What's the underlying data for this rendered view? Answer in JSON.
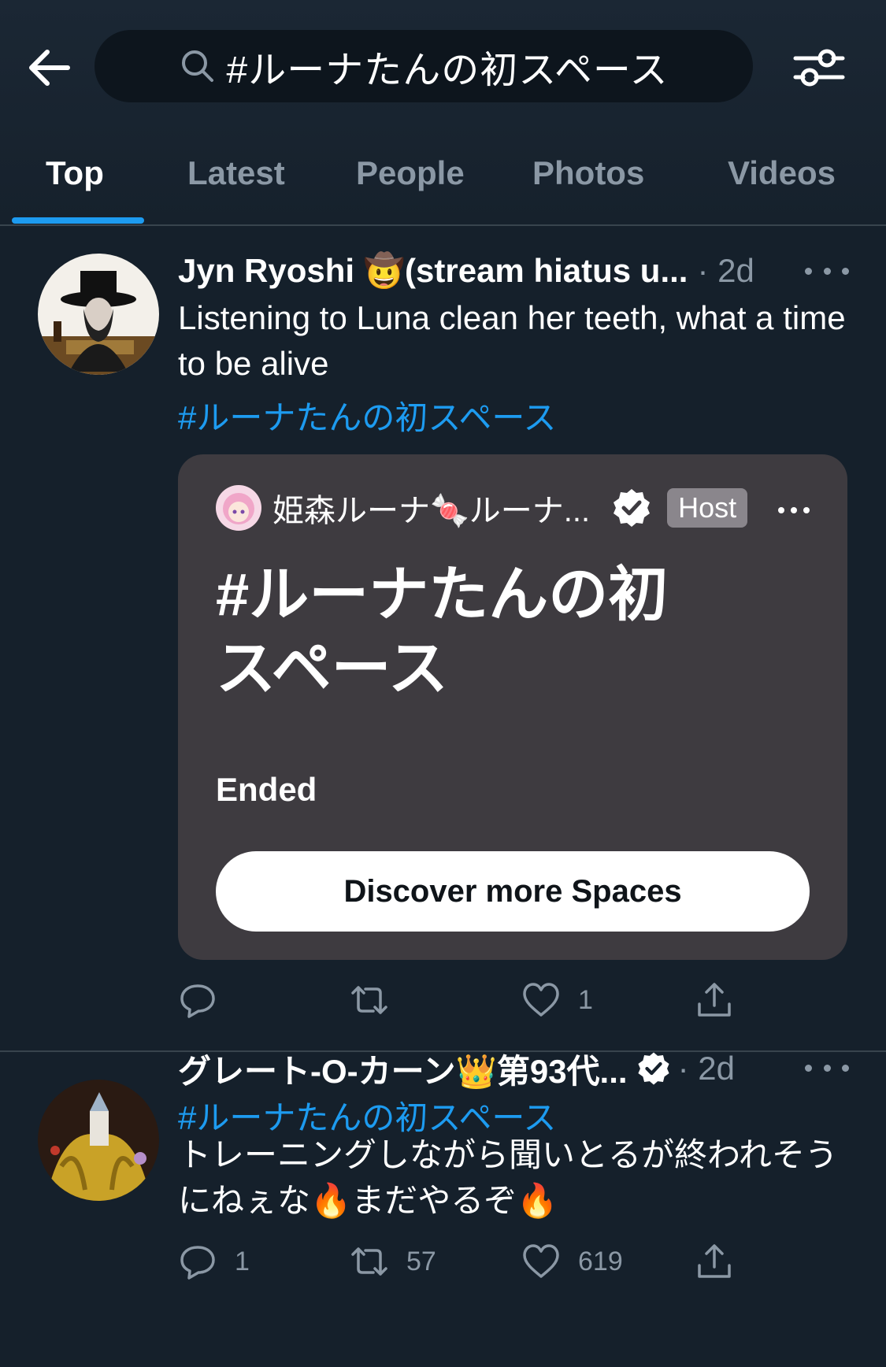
{
  "search": {
    "query": "#ルーナたんの初スペース"
  },
  "tabs": [
    {
      "label": "Top",
      "active": true
    },
    {
      "label": "Latest",
      "active": false
    },
    {
      "label": "People",
      "active": false
    },
    {
      "label": "Photos",
      "active": false
    },
    {
      "label": "Videos",
      "active": false
    }
  ],
  "tweets": [
    {
      "display_name": "Jyn Ryoshi 🤠(stream hiatus u...",
      "time": "· 2d",
      "text": "Listening to Luna clean her teeth, what a time to be alive",
      "hashtag": "#ルーナたんの初スペース",
      "space": {
        "host_name": "姫森ルーナ🍬ルーナ...",
        "host_badge": "Host",
        "title": "#ルーナたんの初スペース",
        "status": "Ended",
        "button_label": "Discover more Spaces"
      },
      "actions": {
        "replies": "",
        "retweets": "",
        "likes": "1"
      }
    },
    {
      "display_name": "グレート-O-カーン👑第93代...",
      "time": "· 2d",
      "hashtag": "#ルーナたんの初スペース",
      "text": "トレーニングしながら聞いとるが終われそうにねぇな🔥まだやるぞ🔥",
      "actions": {
        "replies": "1",
        "retweets": "57",
        "likes": "619"
      }
    }
  ],
  "icons": {
    "back": "back-arrow-icon",
    "search": "search-icon",
    "filter": "filter-sliders-icon",
    "reply": "reply-icon",
    "retweet": "retweet-icon",
    "like": "like-icon",
    "share": "share-icon",
    "verified": "verified-badge-icon",
    "more": "more-icon"
  },
  "colors": {
    "background": "#15202b",
    "accent": "#1d9bf0",
    "secondary_text": "#8b98a5",
    "space_card": "#3e3b40"
  }
}
